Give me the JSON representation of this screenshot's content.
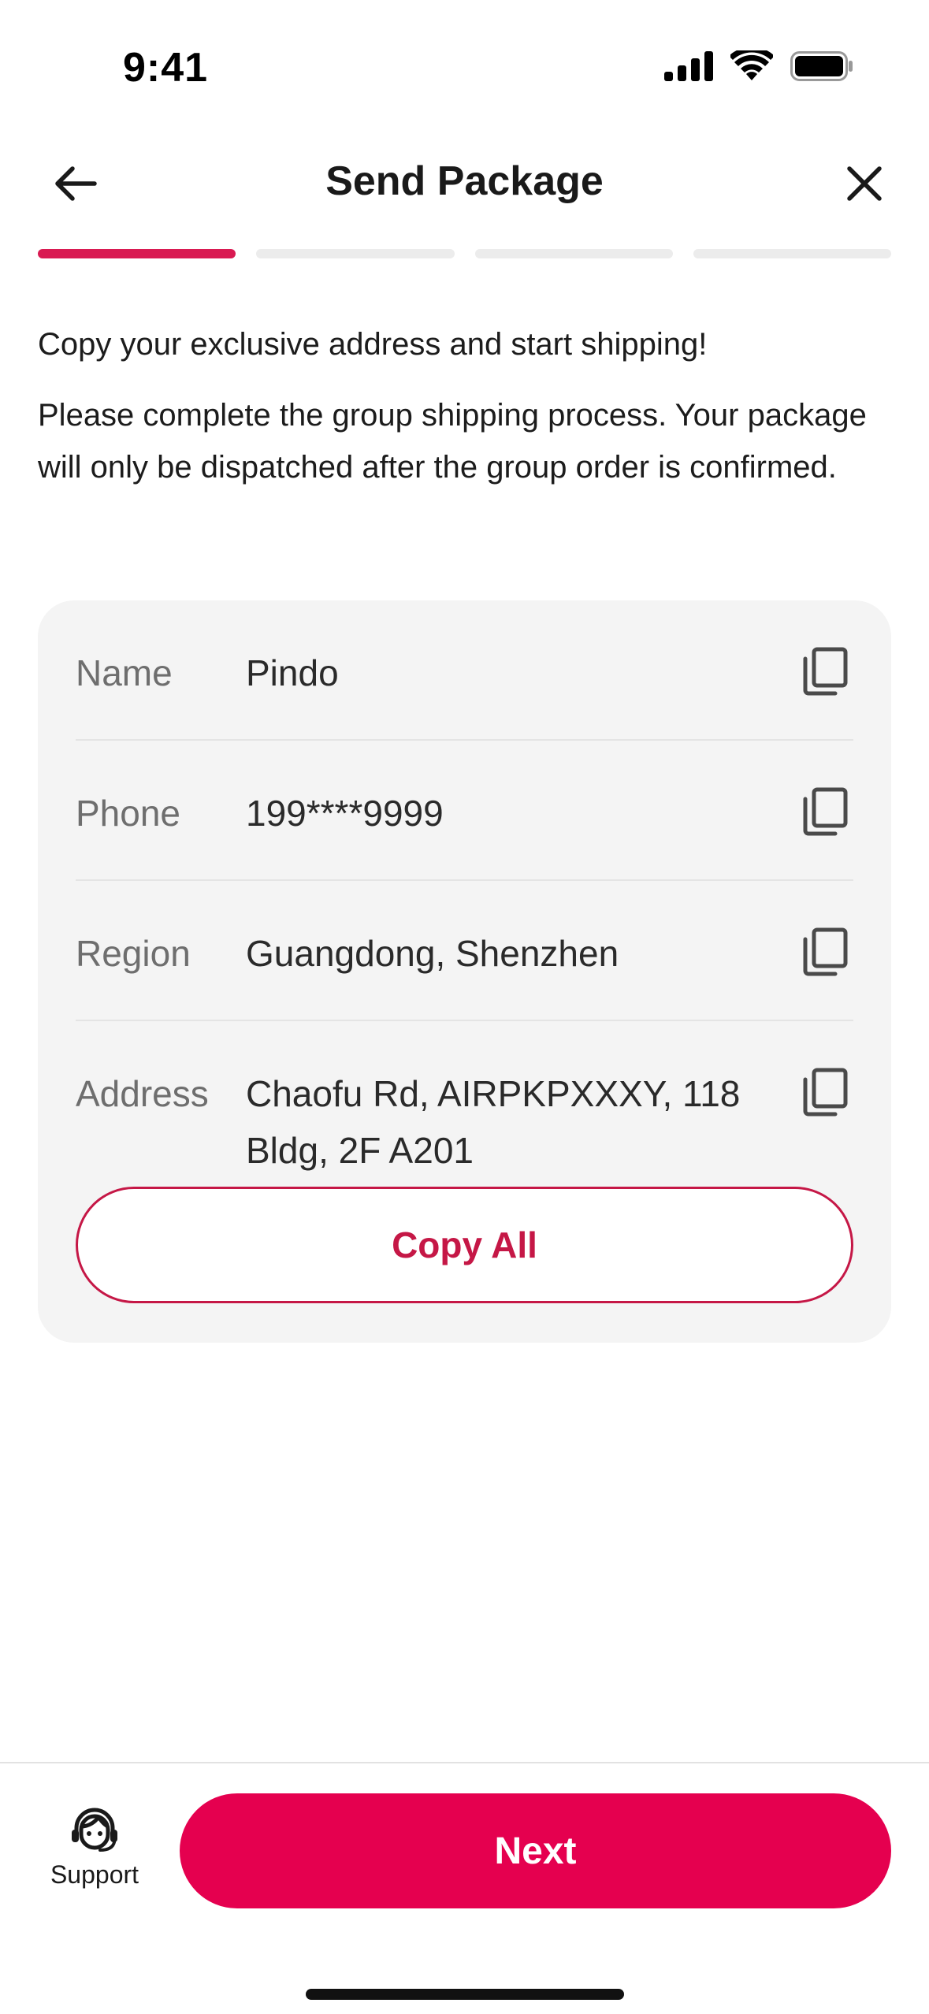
{
  "status_bar": {
    "time": "9:41"
  },
  "header": {
    "title": "Send Package",
    "back_icon": "arrow-left-icon",
    "close_icon": "close-icon"
  },
  "progress": {
    "total_steps": 4,
    "current_step": 1,
    "active_color": "#d91a52"
  },
  "intro": {
    "line1": "Copy your exclusive address and start shipping!",
    "line2": "Please complete the group shipping process. Your package will only be dispatched after the group order is confirmed."
  },
  "address": {
    "rows": [
      {
        "label": "Name",
        "value": "Pindo"
      },
      {
        "label": "Phone",
        "value": "199****9999"
      },
      {
        "label": "Region",
        "value": "Guangdong, Shenzhen"
      },
      {
        "label": "Address",
        "value": "Chaofu Rd, AIRPKPXXXY, 118 Bldg, 2F A201"
      }
    ],
    "copy_icon": "copy-icon",
    "copy_all_label": "Copy All"
  },
  "footer": {
    "support_label": "Support",
    "support_icon": "headset-agent-icon",
    "next_label": "Next",
    "next_color": "#e5004f"
  }
}
